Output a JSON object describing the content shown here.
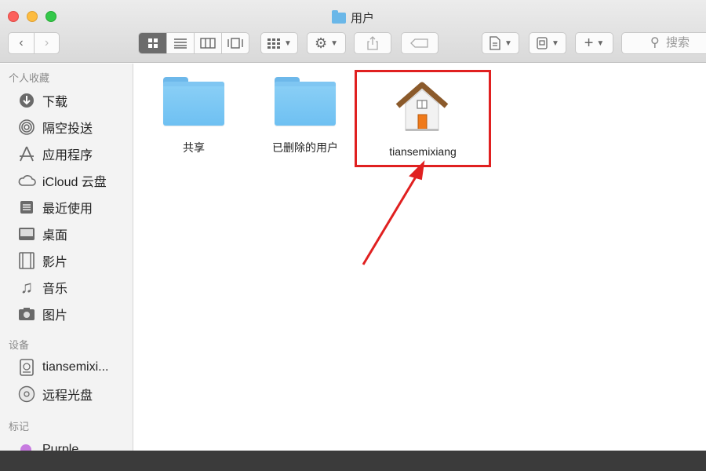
{
  "window": {
    "title": "用户"
  },
  "toolbar": {
    "search_placeholder": "搜索"
  },
  "sidebar": {
    "sections": {
      "favorites": "个人收藏",
      "devices": "设备",
      "tags": "标记"
    },
    "favorites": [
      {
        "label": "下载",
        "icon": "download-icon"
      },
      {
        "label": "隔空投送",
        "icon": "airdrop-icon"
      },
      {
        "label": "应用程序",
        "icon": "applications-icon"
      },
      {
        "label": "iCloud 云盘",
        "icon": "icloud-icon"
      },
      {
        "label": "最近使用",
        "icon": "recents-icon"
      },
      {
        "label": "桌面",
        "icon": "desktop-icon"
      },
      {
        "label": "影片",
        "icon": "movies-icon"
      },
      {
        "label": "音乐",
        "icon": "music-icon"
      },
      {
        "label": "图片",
        "icon": "pictures-icon"
      }
    ],
    "devices": [
      {
        "label": "tiansemixi...",
        "icon": "hard-drive-icon"
      },
      {
        "label": "远程光盘",
        "icon": "remote-disc-icon"
      }
    ],
    "tags": [
      {
        "label": "Purple",
        "color": "#c77be0"
      }
    ]
  },
  "content": {
    "items": [
      {
        "label": "共享",
        "icon": "folder-icon"
      },
      {
        "label": "已删除的用户",
        "icon": "folder-icon"
      },
      {
        "label": "tiansemixiang",
        "icon": "home-icon"
      }
    ]
  },
  "colors": {
    "highlight": "#e02020",
    "folder": "#6ec0f2"
  }
}
